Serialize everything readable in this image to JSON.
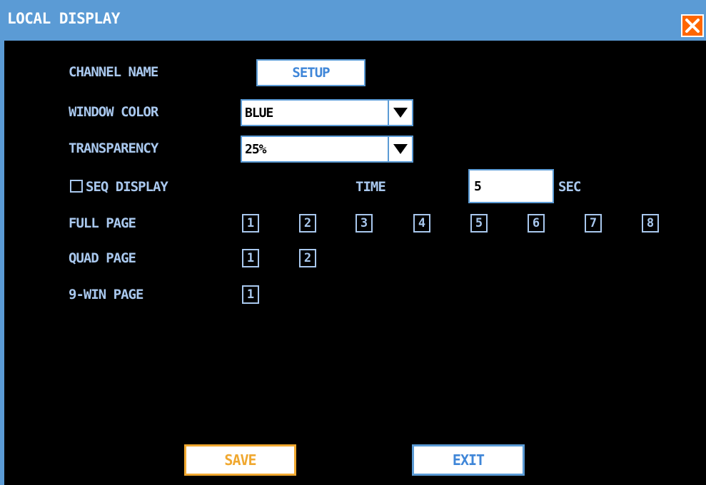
{
  "window": {
    "title": "LOCAL DISPLAY",
    "close_icon": "close-x-icon"
  },
  "colors": {
    "title_bar": "#5b9bd5",
    "background": "#000000",
    "label_text": "#a9c8ee",
    "button_text": "#3f86d8",
    "save_accent": "#f0a830",
    "close_button": "#ff6600"
  },
  "settings": {
    "channel_name_label": "CHANNEL NAME",
    "setup_label": "SETUP",
    "window_color_label": "WINDOW COLOR",
    "window_color_value": "BLUE",
    "transparency_label": "TRANSPARENCY",
    "transparency_value": "25%",
    "seq_display_label": "SEQ DISPLAY",
    "seq_display_checked": false,
    "time_label": "TIME",
    "time_value": "5",
    "sec_label": "SEC"
  },
  "pages": {
    "full_page_label": "FULL PAGE",
    "full_page_items": [
      "1",
      "2",
      "3",
      "4",
      "5",
      "6",
      "7",
      "8"
    ],
    "quad_page_label": "QUAD PAGE",
    "quad_page_items": [
      "1",
      "2"
    ],
    "nine_win_label": "9-WIN PAGE",
    "nine_win_items": [
      "1"
    ]
  },
  "actions": {
    "save_label": "SAVE",
    "exit_label": "EXIT"
  }
}
